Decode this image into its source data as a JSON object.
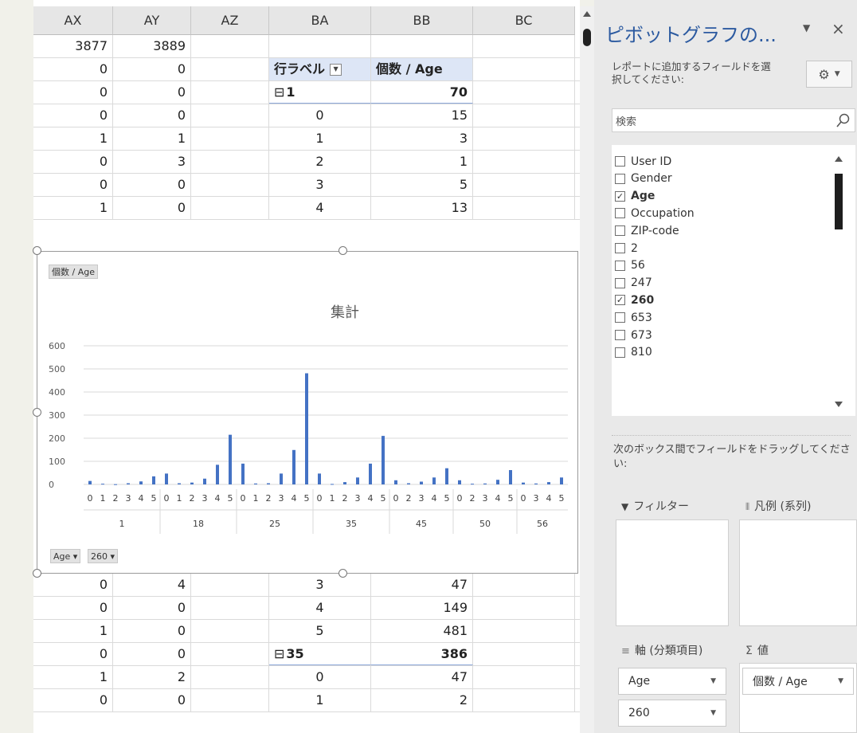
{
  "sheet": {
    "columns": [
      "AX",
      "AY",
      "AZ",
      "BA",
      "BB",
      "BC"
    ],
    "rows_top": [
      {
        "ax": "3877",
        "ay": "3889",
        "ba": "",
        "bb": ""
      },
      {
        "ax": "0",
        "ay": "0",
        "ba": "行ラベル",
        "bb": "個数 / Age"
      },
      {
        "ax": "0",
        "ay": "0",
        "ba": "1",
        "bb": "70"
      },
      {
        "ax": "0",
        "ay": "0",
        "ba": "0",
        "bb": "15"
      },
      {
        "ax": "1",
        "ay": "1",
        "ba": "1",
        "bb": "3"
      },
      {
        "ax": "0",
        "ay": "3",
        "ba": "2",
        "bb": "1"
      },
      {
        "ax": "0",
        "ay": "0",
        "ba": "3",
        "bb": "5"
      },
      {
        "ax": "1",
        "ay": "0",
        "ba": "4",
        "bb": "13"
      }
    ],
    "rows_bottom": [
      {
        "ax": "0",
        "ay": "4",
        "ba": "3",
        "bb": "47"
      },
      {
        "ax": "0",
        "ay": "0",
        "ba": "4",
        "bb": "149"
      },
      {
        "ax": "1",
        "ay": "0",
        "ba": "5",
        "bb": "481"
      },
      {
        "ax": "0",
        "ay": "0",
        "ba": "35",
        "bb": "386"
      },
      {
        "ax": "1",
        "ay": "2",
        "ba": "0",
        "bb": "47"
      },
      {
        "ax": "0",
        "ay": "0",
        "ba": "1",
        "bb": "2"
      }
    ],
    "collapse_symbol": "⊟"
  },
  "chart": {
    "value_button": "個数 / Age",
    "axis_buttons": [
      "Age ▾",
      "260 ▾"
    ]
  },
  "chart_data": {
    "type": "bar",
    "title": "集計",
    "color": "#4472c4",
    "ylim": [
      0,
      600
    ],
    "yticks": [
      0,
      100,
      200,
      300,
      400,
      500,
      600
    ],
    "groups": [
      {
        "label": "1",
        "categories": [
          "0",
          "1",
          "2",
          "3",
          "4",
          "5"
        ],
        "values": [
          15,
          3,
          1,
          5,
          13,
          35
        ]
      },
      {
        "label": "18",
        "categories": [
          "0",
          "1",
          "2",
          "3",
          "4",
          "5"
        ],
        "values": [
          47,
          5,
          8,
          25,
          85,
          215
        ]
      },
      {
        "label": "25",
        "categories": [
          "0",
          "1",
          "2",
          "3",
          "4",
          "5"
        ],
        "values": [
          90,
          4,
          5,
          47,
          149,
          481
        ]
      },
      {
        "label": "35",
        "categories": [
          "0",
          "1",
          "2",
          "3",
          "4",
          "5"
        ],
        "values": [
          47,
          2,
          10,
          30,
          90,
          210
        ]
      },
      {
        "label": "45",
        "categories": [
          "0",
          "2",
          "3",
          "4",
          "5"
        ],
        "values": [
          18,
          5,
          12,
          30,
          70
        ]
      },
      {
        "label": "50",
        "categories": [
          "0",
          "2",
          "3",
          "4",
          "5"
        ],
        "values": [
          18,
          3,
          4,
          20,
          62
        ]
      },
      {
        "label": "56",
        "categories": [
          "0",
          "3",
          "4",
          "5"
        ],
        "values": [
          8,
          4,
          10,
          30
        ]
      }
    ]
  },
  "pane": {
    "title": "ピボットグラフの...",
    "instruction": "レポートに追加するフィールドを選択してください:",
    "search_placeholder": "検索",
    "fields": [
      {
        "label": "User ID",
        "checked": false
      },
      {
        "label": "Gender",
        "checked": false
      },
      {
        "label": "Age",
        "checked": true
      },
      {
        "label": "Occupation",
        "checked": false
      },
      {
        "label": "ZIP-code",
        "checked": false
      },
      {
        "label": "2",
        "checked": false
      },
      {
        "label": "56",
        "checked": false
      },
      {
        "label": "247",
        "checked": false
      },
      {
        "label": "260",
        "checked": true
      },
      {
        "label": "653",
        "checked": false
      },
      {
        "label": "673",
        "checked": false
      },
      {
        "label": "810",
        "checked": false
      }
    ],
    "drag_instruction": "次のボックス間でフィールドをドラッグしてください:",
    "areas": {
      "filter": "フィルター",
      "legend": "凡例 (系列)",
      "axis": "軸 (分類項目)",
      "values": "値"
    },
    "axis_fields": [
      "Age",
      "260"
    ],
    "value_fields": [
      "個数 / Age"
    ]
  }
}
